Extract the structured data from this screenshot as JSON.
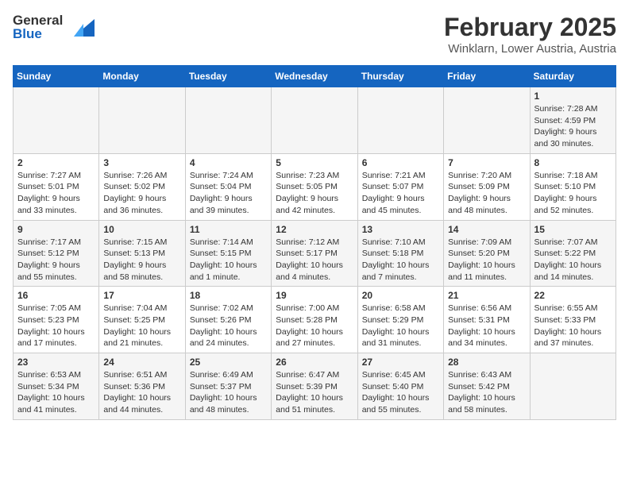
{
  "header": {
    "logo_general": "General",
    "logo_blue": "Blue",
    "title": "February 2025",
    "subtitle": "Winklarn, Lower Austria, Austria"
  },
  "weekdays": [
    "Sunday",
    "Monday",
    "Tuesday",
    "Wednesday",
    "Thursday",
    "Friday",
    "Saturday"
  ],
  "weeks": [
    [
      {
        "day": "",
        "info": ""
      },
      {
        "day": "",
        "info": ""
      },
      {
        "day": "",
        "info": ""
      },
      {
        "day": "",
        "info": ""
      },
      {
        "day": "",
        "info": ""
      },
      {
        "day": "",
        "info": ""
      },
      {
        "day": "1",
        "info": "Sunrise: 7:28 AM\nSunset: 4:59 PM\nDaylight: 9 hours and 30 minutes."
      }
    ],
    [
      {
        "day": "2",
        "info": "Sunrise: 7:27 AM\nSunset: 5:01 PM\nDaylight: 9 hours and 33 minutes."
      },
      {
        "day": "3",
        "info": "Sunrise: 7:26 AM\nSunset: 5:02 PM\nDaylight: 9 hours and 36 minutes."
      },
      {
        "day": "4",
        "info": "Sunrise: 7:24 AM\nSunset: 5:04 PM\nDaylight: 9 hours and 39 minutes."
      },
      {
        "day": "5",
        "info": "Sunrise: 7:23 AM\nSunset: 5:05 PM\nDaylight: 9 hours and 42 minutes."
      },
      {
        "day": "6",
        "info": "Sunrise: 7:21 AM\nSunset: 5:07 PM\nDaylight: 9 hours and 45 minutes."
      },
      {
        "day": "7",
        "info": "Sunrise: 7:20 AM\nSunset: 5:09 PM\nDaylight: 9 hours and 48 minutes."
      },
      {
        "day": "8",
        "info": "Sunrise: 7:18 AM\nSunset: 5:10 PM\nDaylight: 9 hours and 52 minutes."
      }
    ],
    [
      {
        "day": "9",
        "info": "Sunrise: 7:17 AM\nSunset: 5:12 PM\nDaylight: 9 hours and 55 minutes."
      },
      {
        "day": "10",
        "info": "Sunrise: 7:15 AM\nSunset: 5:13 PM\nDaylight: 9 hours and 58 minutes."
      },
      {
        "day": "11",
        "info": "Sunrise: 7:14 AM\nSunset: 5:15 PM\nDaylight: 10 hours and 1 minute."
      },
      {
        "day": "12",
        "info": "Sunrise: 7:12 AM\nSunset: 5:17 PM\nDaylight: 10 hours and 4 minutes."
      },
      {
        "day": "13",
        "info": "Sunrise: 7:10 AM\nSunset: 5:18 PM\nDaylight: 10 hours and 7 minutes."
      },
      {
        "day": "14",
        "info": "Sunrise: 7:09 AM\nSunset: 5:20 PM\nDaylight: 10 hours and 11 minutes."
      },
      {
        "day": "15",
        "info": "Sunrise: 7:07 AM\nSunset: 5:22 PM\nDaylight: 10 hours and 14 minutes."
      }
    ],
    [
      {
        "day": "16",
        "info": "Sunrise: 7:05 AM\nSunset: 5:23 PM\nDaylight: 10 hours and 17 minutes."
      },
      {
        "day": "17",
        "info": "Sunrise: 7:04 AM\nSunset: 5:25 PM\nDaylight: 10 hours and 21 minutes."
      },
      {
        "day": "18",
        "info": "Sunrise: 7:02 AM\nSunset: 5:26 PM\nDaylight: 10 hours and 24 minutes."
      },
      {
        "day": "19",
        "info": "Sunrise: 7:00 AM\nSunset: 5:28 PM\nDaylight: 10 hours and 27 minutes."
      },
      {
        "day": "20",
        "info": "Sunrise: 6:58 AM\nSunset: 5:29 PM\nDaylight: 10 hours and 31 minutes."
      },
      {
        "day": "21",
        "info": "Sunrise: 6:56 AM\nSunset: 5:31 PM\nDaylight: 10 hours and 34 minutes."
      },
      {
        "day": "22",
        "info": "Sunrise: 6:55 AM\nSunset: 5:33 PM\nDaylight: 10 hours and 37 minutes."
      }
    ],
    [
      {
        "day": "23",
        "info": "Sunrise: 6:53 AM\nSunset: 5:34 PM\nDaylight: 10 hours and 41 minutes."
      },
      {
        "day": "24",
        "info": "Sunrise: 6:51 AM\nSunset: 5:36 PM\nDaylight: 10 hours and 44 minutes."
      },
      {
        "day": "25",
        "info": "Sunrise: 6:49 AM\nSunset: 5:37 PM\nDaylight: 10 hours and 48 minutes."
      },
      {
        "day": "26",
        "info": "Sunrise: 6:47 AM\nSunset: 5:39 PM\nDaylight: 10 hours and 51 minutes."
      },
      {
        "day": "27",
        "info": "Sunrise: 6:45 AM\nSunset: 5:40 PM\nDaylight: 10 hours and 55 minutes."
      },
      {
        "day": "28",
        "info": "Sunrise: 6:43 AM\nSunset: 5:42 PM\nDaylight: 10 hours and 58 minutes."
      },
      {
        "day": "",
        "info": ""
      }
    ]
  ]
}
